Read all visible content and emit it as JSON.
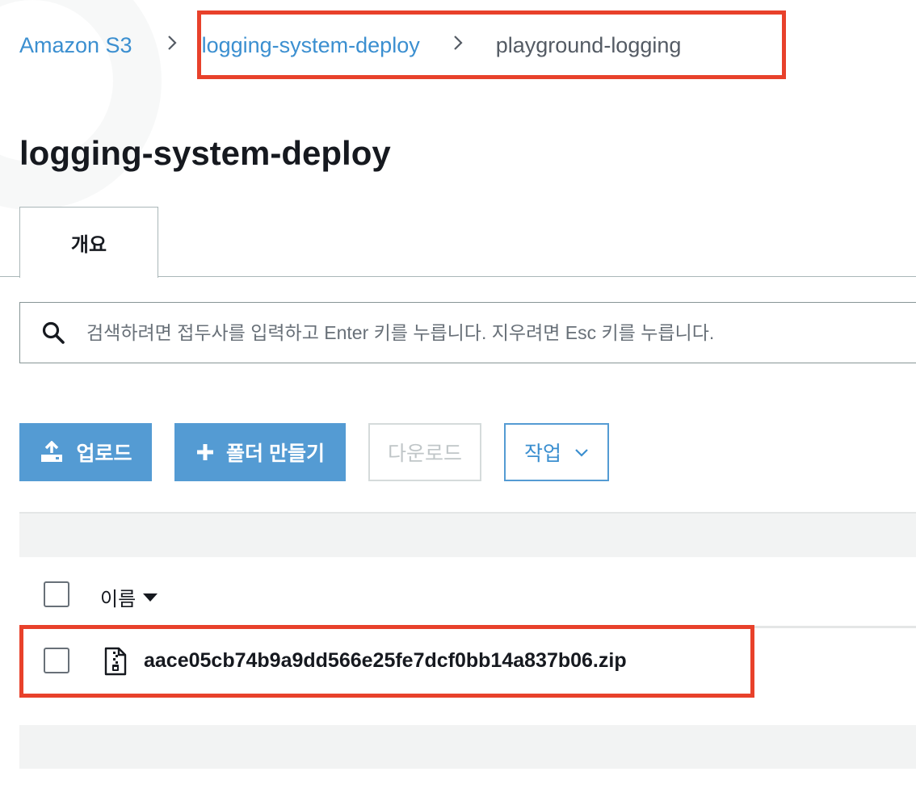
{
  "breadcrumb": {
    "root": "Amazon S3",
    "bucket": "logging-system-deploy",
    "folder": "playground-logging",
    "separator_icon": "chevron-right-icon"
  },
  "page_title": "logging-system-deploy",
  "tabs": [
    {
      "label": "개요",
      "active": true
    }
  ],
  "search": {
    "placeholder": "검색하려면 접두사를 입력하고 Enter 키를 누릅니다. 지우려면 Esc 키를 누릅니다.",
    "value": ""
  },
  "toolbar": {
    "upload_label": "업로드",
    "create_folder_label": "폴더 만들기",
    "download_label": "다운로드",
    "actions_label": "작업"
  },
  "table": {
    "columns": [
      {
        "label": "이름",
        "sort": "descending"
      }
    ],
    "rows": [
      {
        "name": "aace05cb74b9a9dd566e25fe7dcf0bb14a837b06.zip",
        "type": "zip",
        "checked": false
      }
    ]
  },
  "colors": {
    "link": "#3b8fd0",
    "primary_button": "#549bd3",
    "highlight": "#e8412b"
  }
}
